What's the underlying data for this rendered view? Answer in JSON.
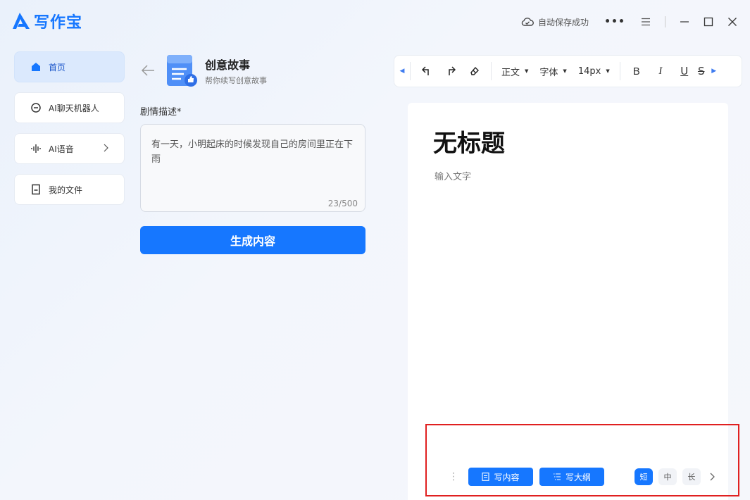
{
  "app": {
    "name": "写作宝",
    "autosave": "自动保存成功"
  },
  "icons": {
    "logo": "logo-icon",
    "cloud": "cloud-icon",
    "more": "more-icon",
    "menu": "menu-icon",
    "minimize": "minimize-icon",
    "maximize": "maximize-icon",
    "close": "close-icon"
  },
  "sidebar": {
    "items": [
      {
        "label": "首页",
        "icon": "home-icon",
        "active": true
      },
      {
        "label": "AI聊天机器人",
        "icon": "chat-icon"
      },
      {
        "label": "AI语音",
        "icon": "voice-icon",
        "has_submenu": true
      },
      {
        "label": "我的文件",
        "icon": "file-icon"
      }
    ]
  },
  "panel": {
    "title": "创意故事",
    "subtitle": "帮你续写创意故事",
    "field_label": "剧情描述*",
    "field_value": "有一天，小明起床的时候发现自己的房间里正在下雨",
    "char_count": "23/500",
    "generate_label": "生成内容"
  },
  "toolbar": {
    "style": "正文",
    "font": "字体",
    "size": "14px",
    "bold": "B",
    "italic": "I",
    "underline": "U",
    "strike": "S"
  },
  "editor": {
    "title": "无标题",
    "placeholder": "输入文字"
  },
  "bottom_bar": {
    "write_content": "写内容",
    "write_outline": "写大纲",
    "lengths": [
      "短",
      "中",
      "长"
    ],
    "selected_length": "短"
  },
  "colors": {
    "accent": "#1677ff",
    "highlight": "#e02020"
  }
}
